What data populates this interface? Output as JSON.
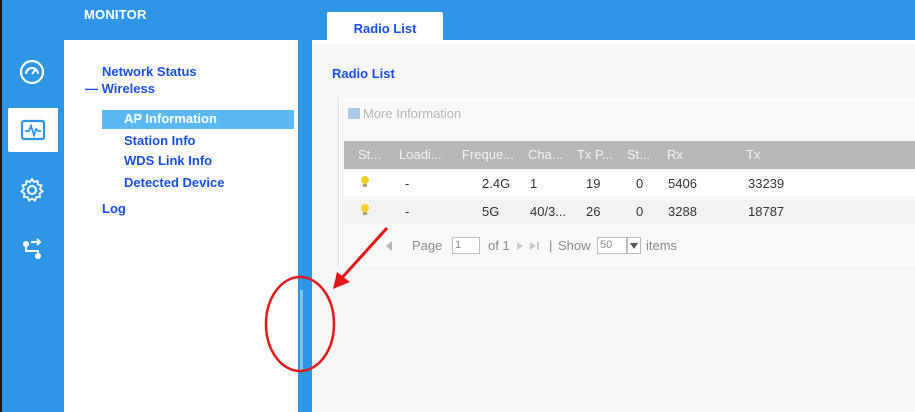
{
  "header": {
    "monitor_label": "MONITOR"
  },
  "rail": {
    "icons": [
      "dashboard-gauge-icon",
      "monitor-pulse-icon",
      "settings-gear-icon",
      "maintenance-network-icon"
    ],
    "selected_index": 1
  },
  "menu": {
    "network_status": "Network Status",
    "wireless": "— Wireless",
    "ap_information": "AP Information",
    "station_info": "Station Info",
    "wds_link_info": "WDS Link Info",
    "detected_device": "Detected Device",
    "log": "Log"
  },
  "tab": {
    "label": "Radio List"
  },
  "section": {
    "title": "Radio List"
  },
  "toolbar": {
    "more_info": "More Information"
  },
  "table": {
    "columns": [
      "St...",
      "Loadi...",
      "Freque...",
      "Cha...",
      "Tx P...",
      "St...",
      "Rx",
      "Tx"
    ],
    "rows": [
      {
        "load": "-",
        "freq": "2.4G",
        "channel": "1",
        "tx_power": "19",
        "stations": "0",
        "rx": "5406",
        "tx": "33239"
      },
      {
        "load": "-",
        "freq": "5G",
        "channel": "40/3...",
        "tx_power": "26",
        "stations": "0",
        "rx": "3288",
        "tx": "18787"
      }
    ]
  },
  "pager": {
    "page_label": "Page",
    "page_value": "1",
    "of_label": "of 1",
    "show_label": "Show",
    "show_value": "50",
    "items_label": "items"
  },
  "colors": {
    "brand_blue": "#2f95e6",
    "link_blue": "#1a4fe6",
    "active_item": "#5bb8f0",
    "annotation_red": "#e01818"
  }
}
